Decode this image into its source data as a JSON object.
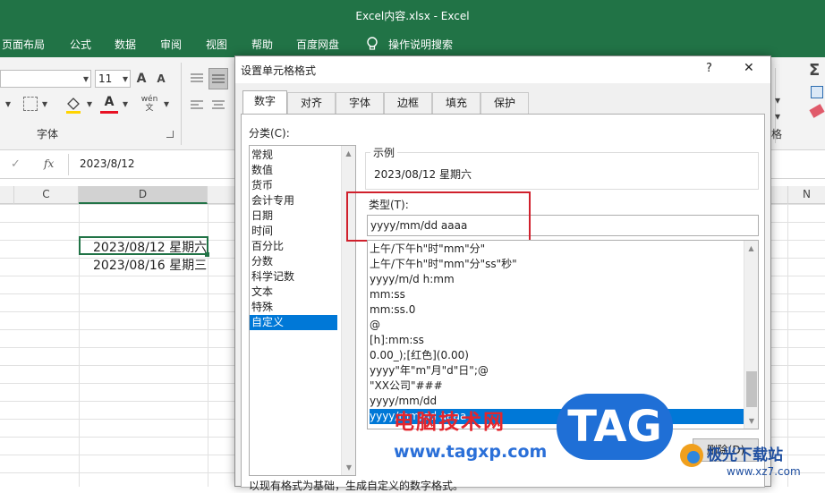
{
  "window": {
    "title": "Excel内容.xlsx  -  Excel"
  },
  "menu": [
    "页面布局",
    "公式",
    "数据",
    "审阅",
    "视图",
    "帮助",
    "百度网盘",
    "操作说明搜索"
  ],
  "ribbon": {
    "font_size": "11",
    "font_group_label": "字体",
    "font_grow": "A",
    "font_shrink": "A",
    "right_group_label": "格"
  },
  "formula_bar": {
    "fx": "fx",
    "value": "2023/8/12"
  },
  "columns": [
    "C",
    "D",
    "N"
  ],
  "cells": [
    "2023/08/12 星期六",
    "2023/08/16 星期三"
  ],
  "dialog": {
    "title": "设置单元格格式",
    "help": "?",
    "close": "✕",
    "tabs": [
      "数字",
      "对齐",
      "字体",
      "边框",
      "填充",
      "保护"
    ],
    "category_label": "分类(C):",
    "categories": [
      "常规",
      "数值",
      "货币",
      "会计专用",
      "日期",
      "时间",
      "百分比",
      "分数",
      "科学记数",
      "文本",
      "特殊",
      "自定义"
    ],
    "sample_label": "示例",
    "sample_value": "2023/08/12 星期六",
    "type_label": "类型(T):",
    "type_value": "yyyy/mm/dd aaaa",
    "formats": [
      "上午/下午h\"时\"mm\"分\"",
      "上午/下午h\"时\"mm\"分\"ss\"秒\"",
      "yyyy/m/d h:mm",
      "mm:ss",
      "mm:ss.0",
      "@",
      "[h]:mm:ss",
      "0.00_);[红色](0.00)",
      "yyyy\"年\"m\"月\"d\"日\";@",
      "\"XX公司\"###",
      "yyyy/mm/dd",
      "yyyy/mm/dd aaaa"
    ],
    "delete_button": "删除(D)",
    "footer_text": "以现有格式为基础，生成自定义的数字格式。"
  },
  "watermark": {
    "text1": "电脑技术网",
    "url": "www.tagxp.com",
    "logo": "TAG",
    "site2": "极光下载站",
    "url2": "www.xz7.com"
  },
  "colors": {
    "excel_green": "#217346",
    "selection_blue": "#0078d7",
    "highlight_red": "#d0202c"
  }
}
